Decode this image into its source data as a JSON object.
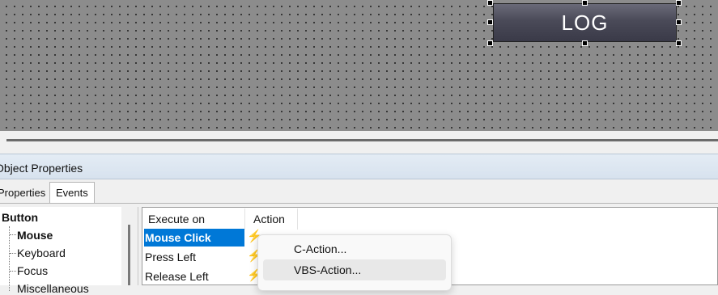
{
  "canvas": {
    "log_button_label": "LOG"
  },
  "panel": {
    "title": "Object Properties",
    "tabs": [
      {
        "label": "Properties"
      },
      {
        "label": "Events"
      }
    ]
  },
  "tree": {
    "root": "Button",
    "children": [
      "Mouse",
      "Keyboard",
      "Focus",
      "Miscellaneous"
    ]
  },
  "events_table": {
    "columns": [
      "Execute on",
      "Action"
    ],
    "rows": [
      {
        "label": "Mouse Click",
        "selected": true
      },
      {
        "label": "Press Left",
        "selected": false
      },
      {
        "label": "Release Left",
        "selected": false
      }
    ]
  },
  "context_menu": {
    "items": [
      "C-Action...",
      "VBS-Action..."
    ]
  },
  "colors": {
    "selection": "#0078d7",
    "bolt_active": "#2aa9c9"
  },
  "icons": [
    "lightning-icon"
  ]
}
